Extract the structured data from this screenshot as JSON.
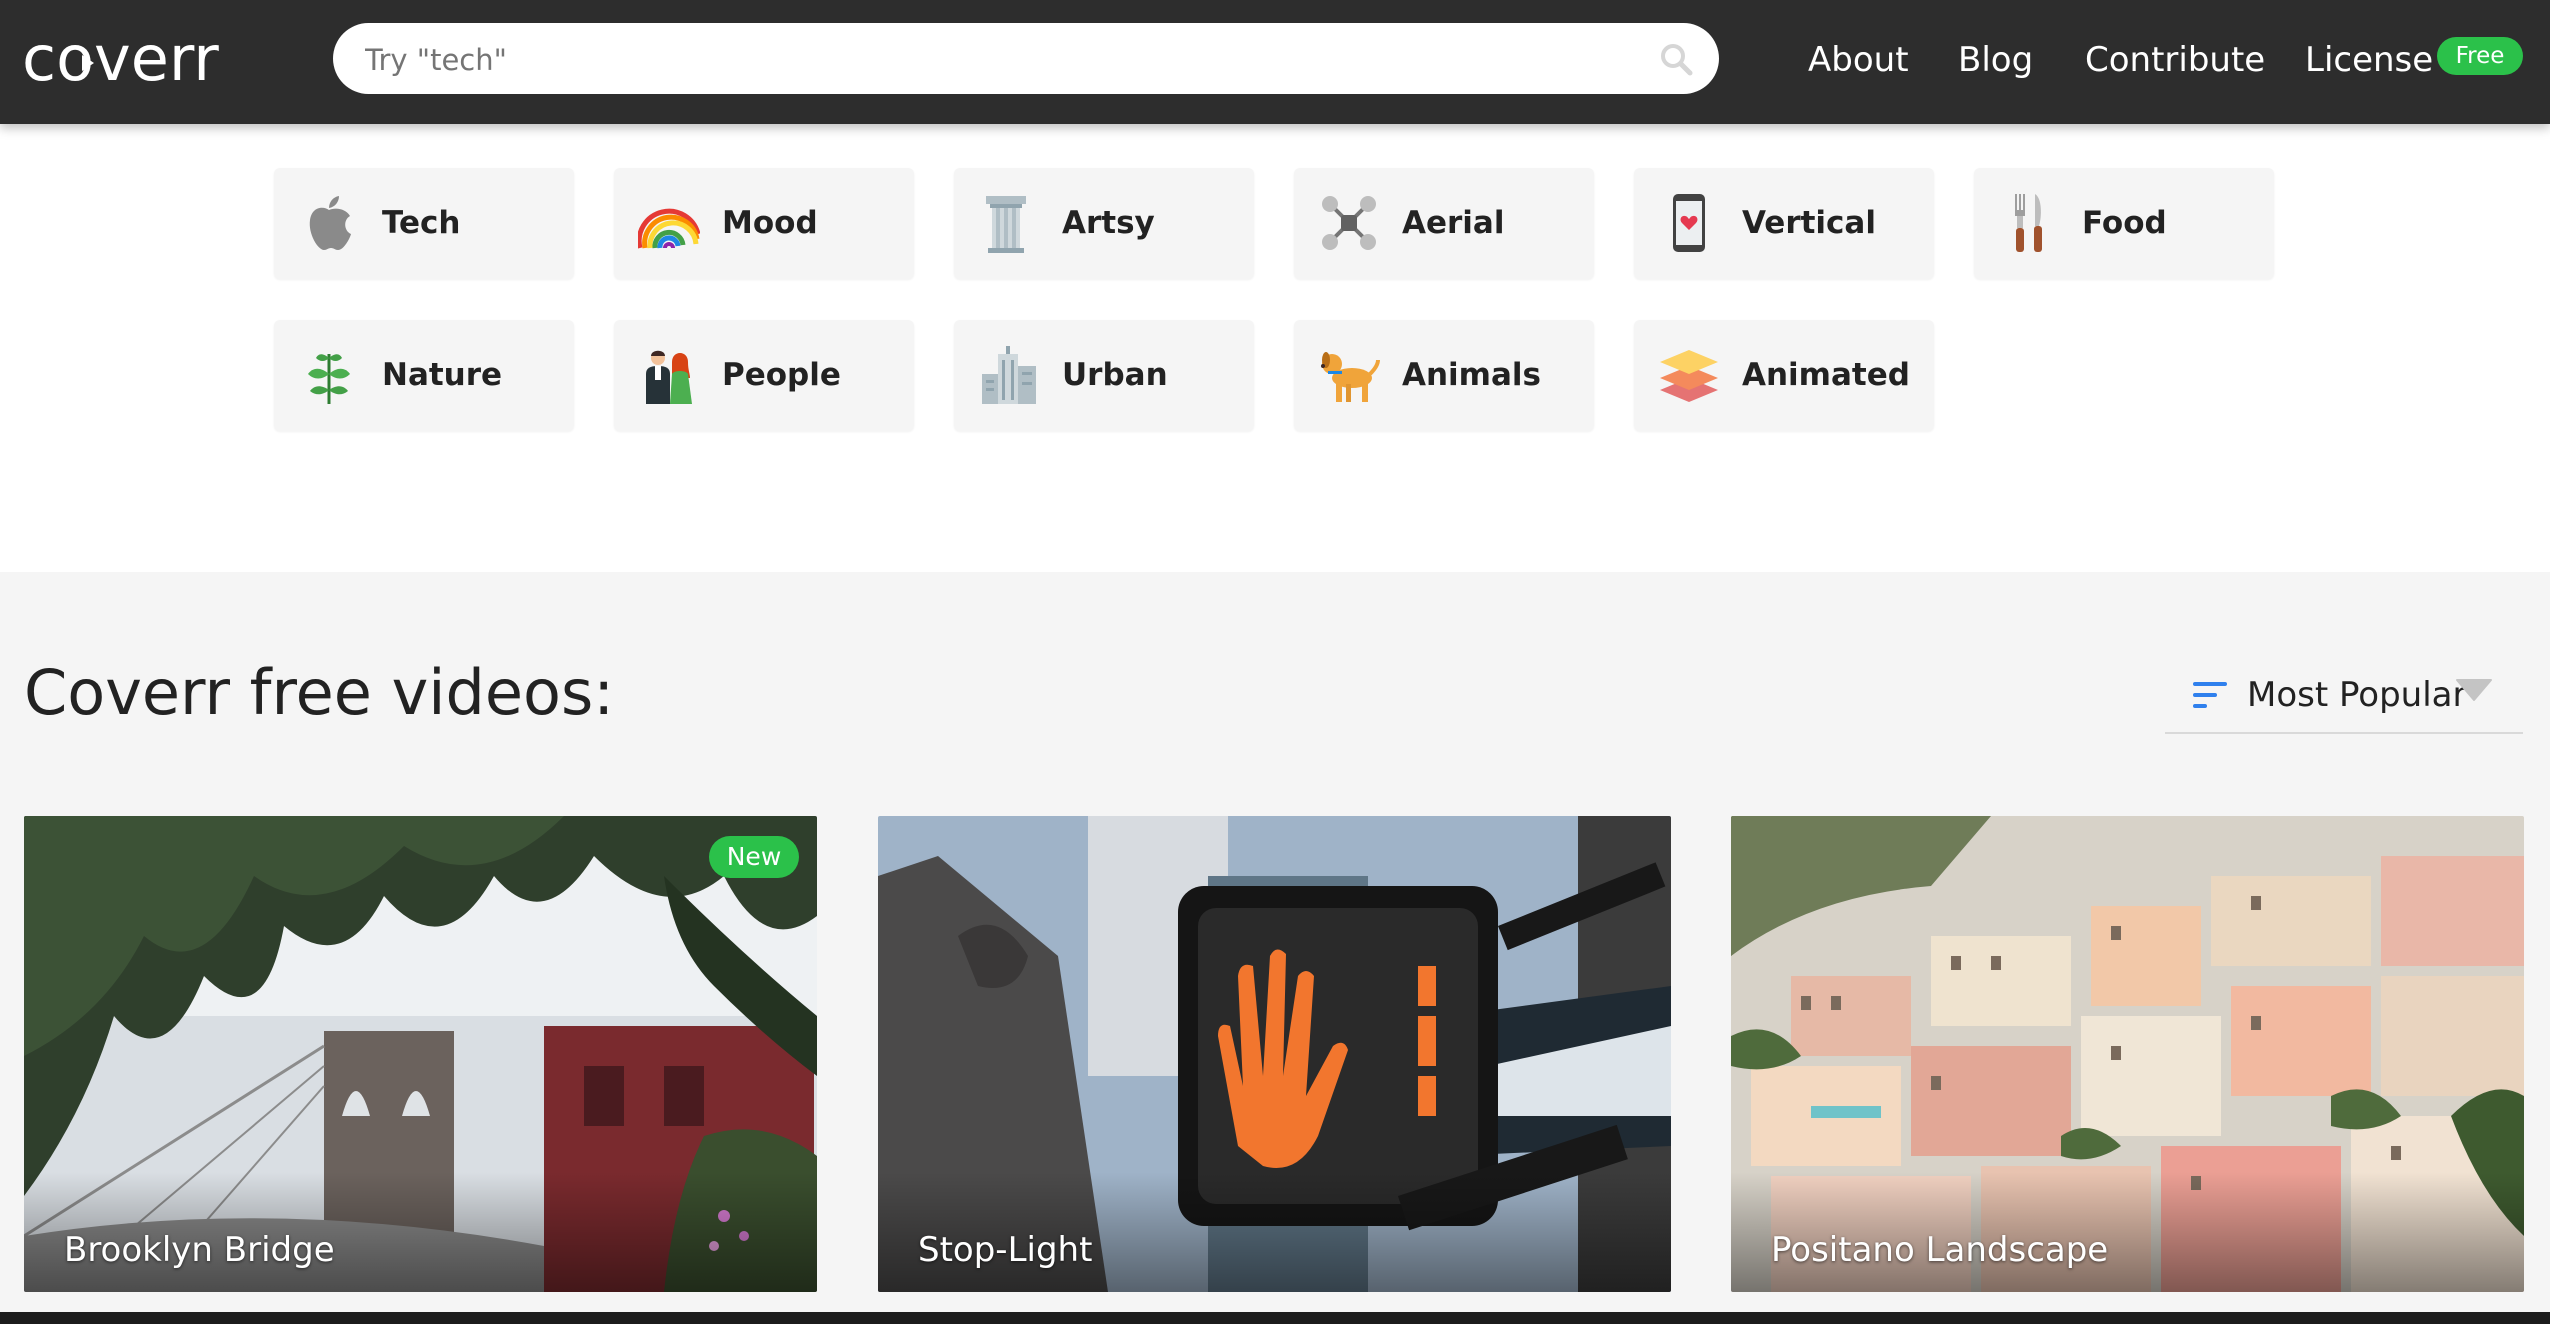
{
  "header": {
    "logo_text": "coverr",
    "search_placeholder": "Try \"tech\"",
    "nav": {
      "about": "About",
      "blog": "Blog",
      "contribute": "Contribute",
      "license": "License",
      "license_badge": "Free"
    }
  },
  "categories": [
    {
      "label": "Tech",
      "icon": "apple-icon"
    },
    {
      "label": "Mood",
      "icon": "rainbow-icon"
    },
    {
      "label": "Artsy",
      "icon": "column-icon"
    },
    {
      "label": "Aerial",
      "icon": "drone-icon"
    },
    {
      "label": "Vertical",
      "icon": "phone-icon"
    },
    {
      "label": "Food",
      "icon": "cutlery-icon"
    },
    {
      "label": "Nature",
      "icon": "plant-icon"
    },
    {
      "label": "People",
      "icon": "people-icon"
    },
    {
      "label": "Urban",
      "icon": "buildings-icon"
    },
    {
      "label": "Animals",
      "icon": "dog-icon"
    },
    {
      "label": "Animated",
      "icon": "layers-icon"
    }
  ],
  "videos_section": {
    "title": "Coverr free videos:",
    "sort_label": "Most Popular",
    "cards": [
      {
        "title": "Brooklyn Bridge",
        "badge": "New"
      },
      {
        "title": "Stop-Light"
      },
      {
        "title": "Positano Landscape"
      }
    ]
  },
  "colors": {
    "header_bg": "#2d2d2d",
    "badge_green": "#2bc14a",
    "category_bg": "#f5f5f5",
    "sort_icon_blue": "#2f80ed"
  }
}
